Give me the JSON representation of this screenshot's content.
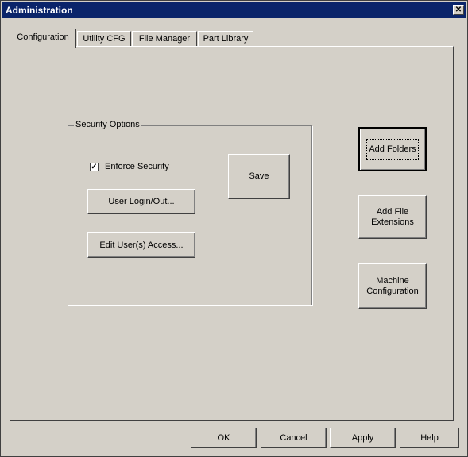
{
  "window": {
    "title": "Administration",
    "close_glyph": "✕"
  },
  "tabs": [
    "Configuration",
    "Utility CFG",
    "File Manager",
    "Part Library"
  ],
  "security": {
    "group_label": "Security Options",
    "enforce_label": "Enforce Security",
    "enforce_checked": true,
    "check_glyph": "✓",
    "user_login_label": "User Login/Out...",
    "edit_access_label": "Edit User(s) Access...",
    "save_label": "Save"
  },
  "side_buttons": {
    "add_folders": "Add Folders",
    "add_file_ext": "Add File Extensions",
    "machine_config": "Machine Configuration"
  },
  "footer": {
    "ok": "OK",
    "cancel": "Cancel",
    "apply": "Apply",
    "help": "Help"
  },
  "colors": {
    "titlebar": "#0a246a",
    "face": "#d4d0c8"
  }
}
